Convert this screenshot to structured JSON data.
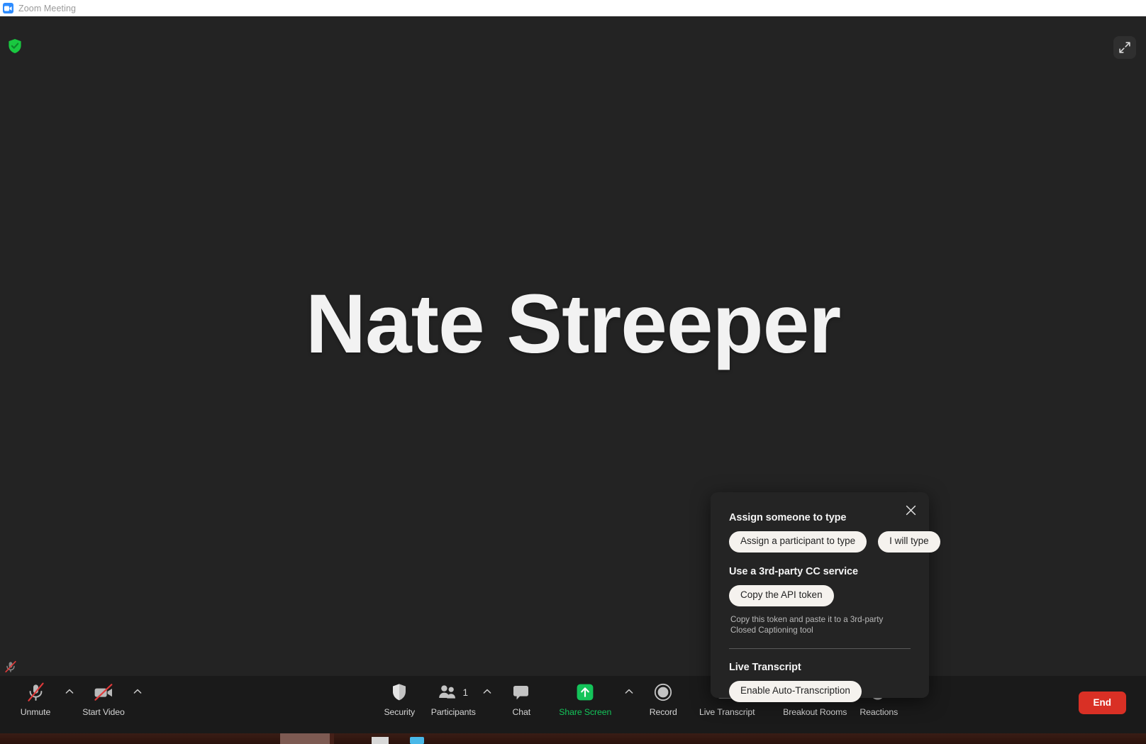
{
  "window": {
    "title": "Zoom Meeting",
    "app_icon": "zoom-video-icon"
  },
  "stage": {
    "speaker_name": "Nate Streeper",
    "encryption_badge_icon": "green-shield-check-icon",
    "expand_icon": "expand-fullscreen-icon",
    "background_color": "#232323"
  },
  "cc_popup": {
    "close_icon": "close-x-icon",
    "assign_heading": "Assign someone to type",
    "assign_participant_label": "Assign a participant to type",
    "i_will_type_label": "I will type",
    "third_party_heading": "Use a 3rd-party CC service",
    "copy_api_token_label": "Copy the API token",
    "copy_note": "Copy this token and paste it to a 3rd-party Closed Captioning tool",
    "live_transcript_heading": "Live Transcript",
    "enable_auto_transcription_label": "Enable Auto-Transcription"
  },
  "toolbar": {
    "items": [
      {
        "key": "audio",
        "label": "Unmute",
        "icon": "microphone-muted-icon",
        "has_caret": true,
        "accent": "default"
      },
      {
        "key": "video",
        "label": "Start Video",
        "icon": "video-camera-off-icon",
        "has_caret": true,
        "accent": "default"
      },
      {
        "key": "security",
        "label": "Security",
        "icon": "shield-icon",
        "has_caret": false,
        "accent": "default"
      },
      {
        "key": "participants",
        "label": "Participants",
        "icon": "people-icon",
        "has_caret": true,
        "accent": "default",
        "count": "1"
      },
      {
        "key": "chat",
        "label": "Chat",
        "icon": "chat-bubble-icon",
        "has_caret": false,
        "accent": "default"
      },
      {
        "key": "share",
        "label": "Share Screen",
        "icon": "share-screen-arrow-icon",
        "has_caret": true,
        "accent": "green"
      },
      {
        "key": "record",
        "label": "Record",
        "icon": "record-circle-icon",
        "has_caret": false,
        "accent": "default"
      },
      {
        "key": "transcript",
        "label": "Live Transcript",
        "icon": "cc-icon",
        "has_caret": true,
        "accent": "default"
      },
      {
        "key": "breakout",
        "label": "Breakout Rooms",
        "icon": "grid-squares-icon",
        "has_caret": false,
        "accent": "default"
      },
      {
        "key": "reactions",
        "label": "Reactions",
        "icon": "smiley-plus-icon",
        "has_caret": false,
        "accent": "default"
      }
    ],
    "end_label": "End",
    "end_color": "#d93025",
    "share_green": "#14c45a",
    "floating_mic_icon": "microphone-muted-small-icon"
  }
}
